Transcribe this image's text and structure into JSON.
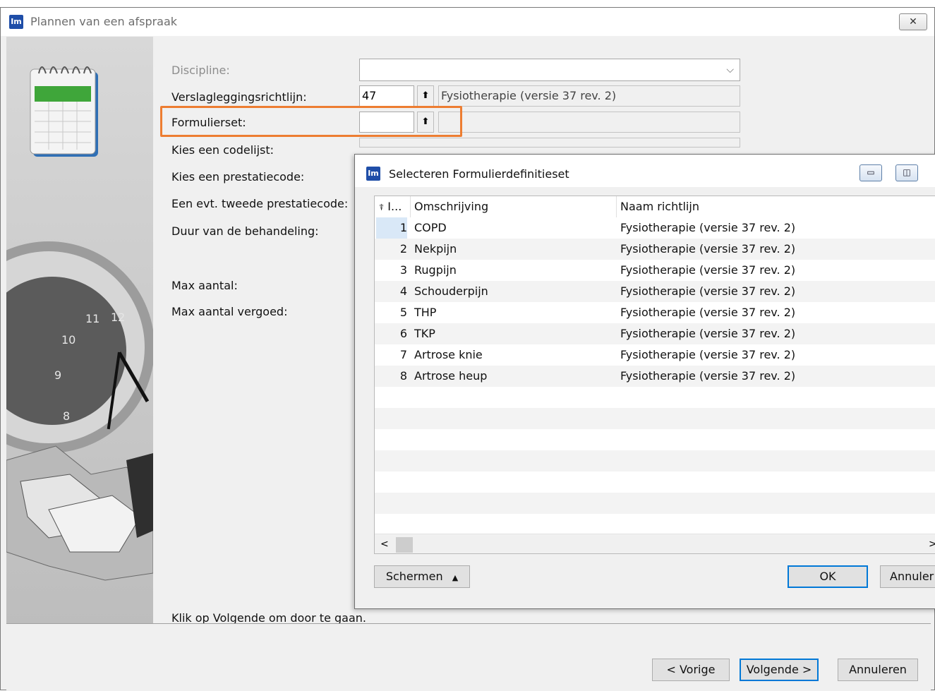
{
  "window": {
    "title": "Plannen van een afspraak",
    "app_icon": "Im",
    "close_glyph": "✕"
  },
  "form": {
    "discipline_label": "Discipline:",
    "discipline_value": "",
    "verslag_label": "Verslagleggingsrichtlijn:",
    "verslag_code": "47",
    "verslag_name": "Fysiotherapie (versie 37 rev. 2)",
    "formulierset_label": "Formulierset:",
    "formulierset_code": "",
    "formulierset_name": "",
    "codelijst_label": "Kies een codelijst:",
    "prestatiecode_label": "Kies een prestatiecode:",
    "tweede_label": "Een evt. tweede prestatiecode:",
    "duur_label": "Duur van de behandeling:",
    "max_label": "Max aantal:",
    "max_vergoed_label": "Max aantal vergoed:",
    "hint": "Klik op Volgende om door te gaan."
  },
  "art": {
    "clock_numbers": [
      "11",
      "12",
      "10",
      "9",
      "8"
    ]
  },
  "footer": {
    "prev": "< Vorige",
    "next": "Volgende >",
    "cancel": "Annuleren"
  },
  "dialog": {
    "title": "Selecteren Formulierdefinitieset",
    "columns": {
      "id": "I...",
      "omschrijving": "Omschrijving",
      "richtlijn": "Naam richtlijn"
    },
    "rows": [
      {
        "id": "1",
        "omschrijving": "COPD",
        "richtlijn": "Fysiotherapie (versie 37 rev. 2)"
      },
      {
        "id": "2",
        "omschrijving": "Nekpijn",
        "richtlijn": "Fysiotherapie (versie 37 rev. 2)"
      },
      {
        "id": "3",
        "omschrijving": "Rugpijn",
        "richtlijn": "Fysiotherapie (versie 37 rev. 2)"
      },
      {
        "id": "4",
        "omschrijving": "Schouderpijn",
        "richtlijn": "Fysiotherapie (versie 37 rev. 2)"
      },
      {
        "id": "5",
        "omschrijving": "THP",
        "richtlijn": "Fysiotherapie (versie 37 rev. 2)"
      },
      {
        "id": "6",
        "omschrijving": "TKP",
        "richtlijn": "Fysiotherapie (versie 37 rev. 2)"
      },
      {
        "id": "7",
        "omschrijving": "Artrose knie",
        "richtlijn": "Fysiotherapie (versie 37 rev. 2)"
      },
      {
        "id": "8",
        "omschrijving": "Artrose heup",
        "richtlijn": "Fysiotherapie (versie 37 rev. 2)"
      }
    ],
    "schermen_label": "Schermen",
    "ok_label": "OK",
    "cancel_label": "Annuler"
  },
  "colors": {
    "highlight": "#ed7d31",
    "focus": "#0078d7",
    "selected_cell": "#d9e8f7"
  }
}
